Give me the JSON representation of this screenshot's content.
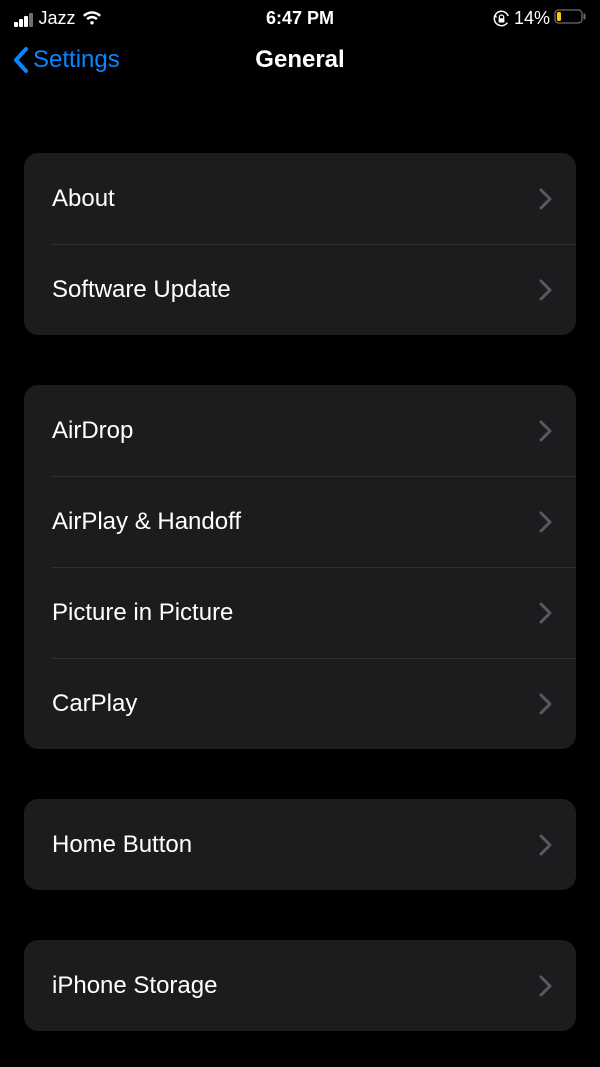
{
  "status": {
    "carrier": "Jazz",
    "time": "6:47 PM",
    "battery_pct": "14%"
  },
  "nav": {
    "back_label": "Settings",
    "title": "General"
  },
  "groups": [
    {
      "rows": [
        {
          "key": "about",
          "label": "About"
        },
        {
          "key": "software-update",
          "label": "Software Update"
        }
      ]
    },
    {
      "rows": [
        {
          "key": "airdrop",
          "label": "AirDrop"
        },
        {
          "key": "airplay-handoff",
          "label": "AirPlay & Handoff"
        },
        {
          "key": "picture-in-picture",
          "label": "Picture in Picture"
        },
        {
          "key": "carplay",
          "label": "CarPlay"
        }
      ]
    },
    {
      "rows": [
        {
          "key": "home-button",
          "label": "Home Button"
        }
      ]
    },
    {
      "rows": [
        {
          "key": "iphone-storage",
          "label": "iPhone Storage"
        }
      ]
    }
  ]
}
